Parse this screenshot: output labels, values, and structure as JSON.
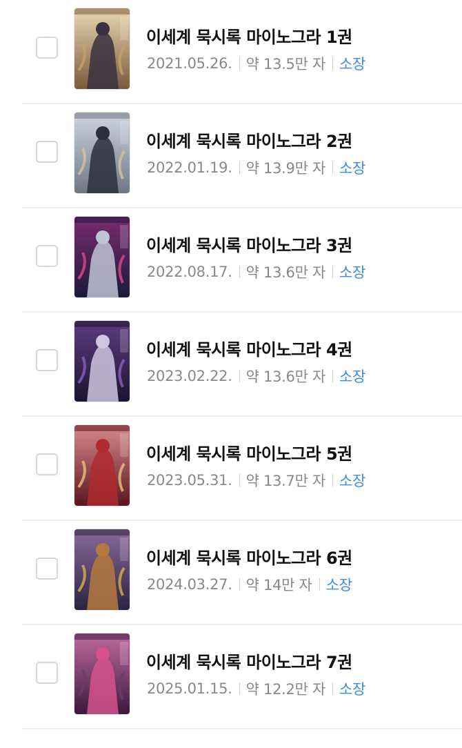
{
  "books": [
    {
      "title": "이세계 묵시록 마이노그라 1권",
      "date": "2021.05.26.",
      "length": "약 13.5만 자",
      "status": "소장",
      "cover_number": "01",
      "cover_colors": {
        "bg1": "#e9d7b2",
        "bg2": "#7a5a3c",
        "figure": "#3a3140",
        "accent": "#c8a06a"
      }
    },
    {
      "title": "이세계 묵시록 마이노그라 2권",
      "date": "2022.01.19.",
      "length": "약 13.9만 자",
      "status": "소장",
      "cover_number": "02",
      "cover_colors": {
        "bg1": "#cfd6de",
        "bg2": "#6e7784",
        "figure": "#2c2f3a",
        "accent": "#d2c2a0"
      }
    },
    {
      "title": "이세계 묵시록 마이노그라 3권",
      "date": "2022.08.17.",
      "length": "약 13.6만 자",
      "status": "소장",
      "cover_number": "03",
      "cover_colors": {
        "bg1": "#7a2a6e",
        "bg2": "#1b1a3a",
        "figure": "#bfc3d6",
        "accent": "#d94a8a"
      }
    },
    {
      "title": "이세계 묵시록 마이노그라 4권",
      "date": "2023.02.22.",
      "length": "약 13.6만 자",
      "status": "소장",
      "cover_number": "04",
      "cover_colors": {
        "bg1": "#5c3d7e",
        "bg2": "#1a1530",
        "figure": "#cfc7e0",
        "accent": "#8b5fc0"
      }
    },
    {
      "title": "이세계 묵시록 마이노그라 5권",
      "date": "2023.05.31.",
      "length": "약 13.7만 자",
      "status": "소장",
      "cover_number": "05",
      "cover_colors": {
        "bg1": "#d98a8a",
        "bg2": "#5a1620",
        "figure": "#b02a30",
        "accent": "#e7c27a"
      }
    },
    {
      "title": "이세계 묵시록 마이노그라 6권",
      "date": "2024.03.27.",
      "length": "약 14만 자",
      "status": "소장",
      "cover_number": "06",
      "cover_colors": {
        "bg1": "#8a6a9a",
        "bg2": "#2a2440",
        "figure": "#b5793f",
        "accent": "#d6b04a"
      }
    },
    {
      "title": "이세계 묵시록 마이노그라 7권",
      "date": "2025.01.15.",
      "length": "약 12.2만 자",
      "status": "소장",
      "cover_number": "07",
      "cover_colors": {
        "bg1": "#c06aa0",
        "bg2": "#3a1a3a",
        "figure": "#d5528e",
        "accent": "#6a3b70"
      }
    }
  ]
}
